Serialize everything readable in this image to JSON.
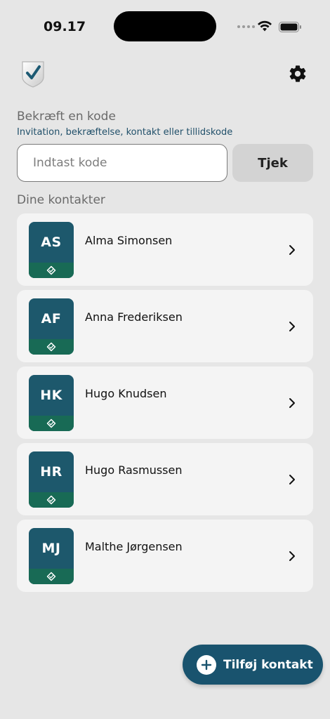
{
  "status_bar": {
    "time": "09.17"
  },
  "header": {
    "logo_icon": "shield-check-icon",
    "settings_icon": "gear-icon"
  },
  "verify": {
    "title": "Bekræft en kode",
    "subtitle": "Invitation, bekræftelse, kontakt eller tillidskode",
    "input_placeholder": "Indtast kode",
    "input_value": "",
    "check_label": "Tjek"
  },
  "contacts": {
    "heading": "Dine kontakter",
    "items": [
      {
        "initials": "AS",
        "name": "Alma Simonsen"
      },
      {
        "initials": "AF",
        "name": "Anna Frederiksen"
      },
      {
        "initials": "HK",
        "name": "Hugo Knudsen"
      },
      {
        "initials": "HR",
        "name": "Hugo Rasmussen"
      },
      {
        "initials": "MJ",
        "name": "Malthe Jørgensen"
      }
    ]
  },
  "fab": {
    "label": "Tilføj kontakt",
    "icon": "plus-icon"
  },
  "colors": {
    "background": "#e6e6e6",
    "card": "#f4f4f4",
    "avatar_top": "#1d586c",
    "avatar_badge": "#186a55",
    "accent": "#19536e",
    "subtitle": "#21506a"
  }
}
